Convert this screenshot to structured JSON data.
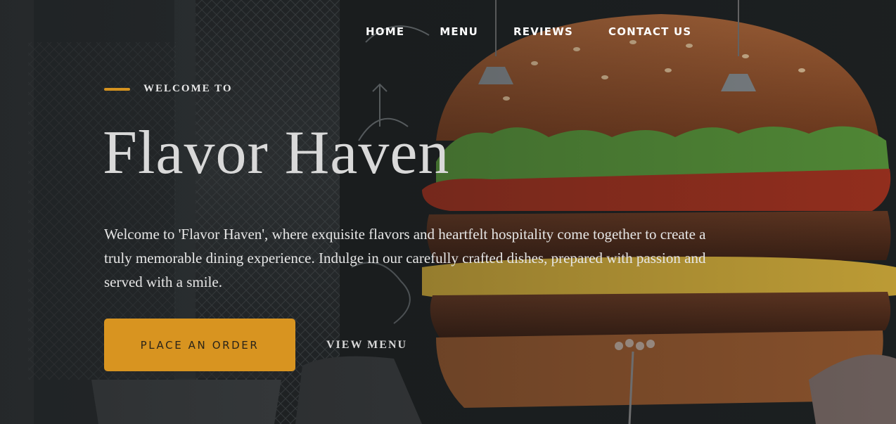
{
  "nav": {
    "items": [
      {
        "label": "HOME"
      },
      {
        "label": "MENU"
      },
      {
        "label": "REVIEWS"
      },
      {
        "label": "CONTACT US"
      }
    ]
  },
  "hero": {
    "eyebrow": "WELCOME TO",
    "title": "Flavor Haven",
    "description": "Welcome to 'Flavor Haven', where exquisite flavors and heartfelt hospitality come together to create a truly memorable dining experience. Indulge in our carefully crafted dishes, prepared with passion and served with a smile.",
    "primary_button": "PLACE AN ORDER",
    "secondary_button": "VIEW MENU"
  },
  "colors": {
    "accent": "#d89420",
    "nav_text": "#ffffff",
    "title_text": "#d9d9d9"
  }
}
